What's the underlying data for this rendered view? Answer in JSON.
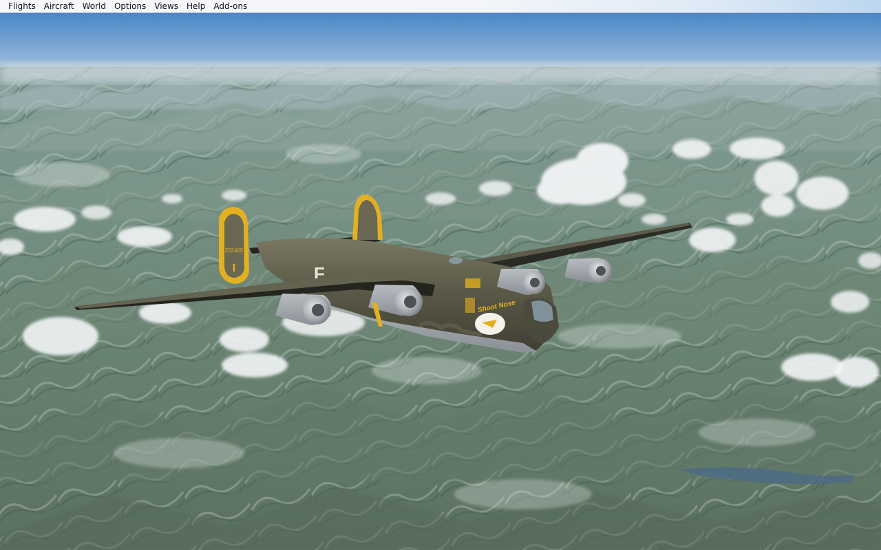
{
  "menubar": {
    "items": [
      {
        "id": "flights",
        "label": "Flights"
      },
      {
        "id": "aircraft",
        "label": "Aircraft"
      },
      {
        "id": "world",
        "label": "World"
      },
      {
        "id": "options",
        "label": "Options"
      },
      {
        "id": "views",
        "label": "Views"
      },
      {
        "id": "help",
        "label": "Help"
      },
      {
        "id": "addons",
        "label": "Add-ons"
      }
    ]
  },
  "scene": {
    "aircraft": {
      "fuselage_letter": "F",
      "tail_serial": "252465",
      "tail_mark": "I",
      "nose_art": "Shoot Nose"
    },
    "colors": {
      "sky_top": "#4a86c8",
      "sky_horizon": "#bcd0dd",
      "terrain": "#71897a",
      "olive_drab": "#5b5a48",
      "tail_yellow": "#e2b021",
      "cloud": "#f2f4f6"
    }
  }
}
